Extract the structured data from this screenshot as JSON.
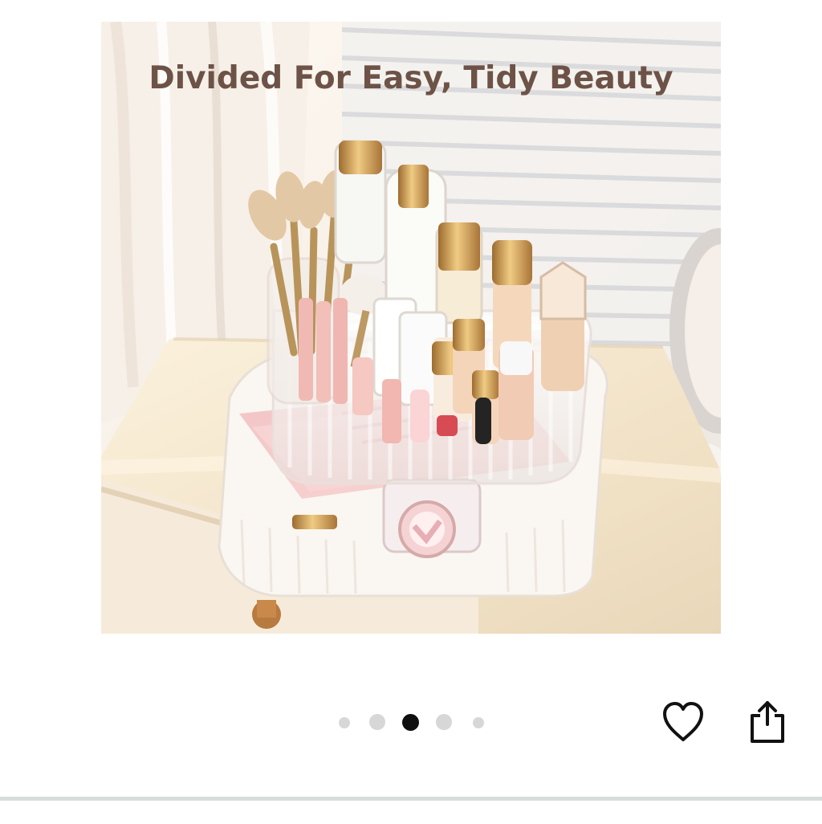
{
  "hero": {
    "headline": "Divided For Easy, Tidy Beauty",
    "palette": {
      "headline": "#6d5347",
      "background": "#f3eadf",
      "table": "#f2e4c8",
      "organizer": "#f8f4ee",
      "gold": "#c79a52",
      "pink": "#f2b8bd"
    }
  },
  "carousel": {
    "total_slides": 5,
    "active_slide": 3
  },
  "actions": {
    "favorite_icon": "heart-outline-icon",
    "share_icon": "share-upload-icon"
  }
}
